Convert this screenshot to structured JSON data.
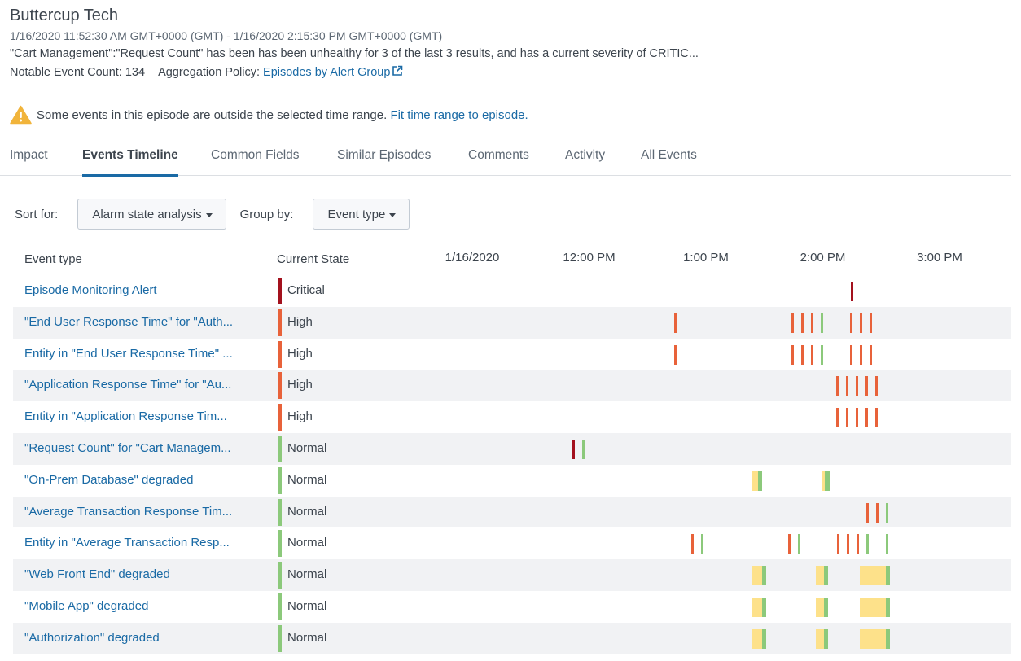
{
  "header": {
    "title": "Buttercup Tech",
    "time_range": "1/16/2020 11:52:30 AM GMT+0000 (GMT) - 1/16/2020 2:15:30 PM GMT+0000 (GMT)",
    "description": "\"Cart Management\":\"Request Count\" has been has been unhealthy for 3 of the last 3 results, and has a current severity of CRITIC...",
    "notable_event_count_label": "Notable Event Count: 134",
    "aggregation_policy_label": "Aggregation Policy:",
    "aggregation_policy_link": "Episodes by Alert Group",
    "external_link_icon": "external-link-icon"
  },
  "warning": {
    "icon": "warning-triangle-icon",
    "text": "Some events in this episode are outside the selected time range.",
    "link": "Fit time range to episode."
  },
  "tabs": [
    {
      "label": "Impact",
      "active": false
    },
    {
      "label": "Events Timeline",
      "active": true
    },
    {
      "label": "Common Fields",
      "active": false
    },
    {
      "label": "Similar Episodes",
      "active": false
    },
    {
      "label": "Comments",
      "active": false
    },
    {
      "label": "Activity",
      "active": false
    },
    {
      "label": "All Events",
      "active": false
    }
  ],
  "controls": {
    "sort_label": "Sort for:",
    "sort_value": "Alarm state analysis",
    "group_label": "Group by:",
    "group_value": "Event type"
  },
  "colors": {
    "critical": "#a3111d",
    "high": "#e8623a",
    "normal": "#8cc97b",
    "medium": "#fde18a",
    "link": "#1a6aa5",
    "row_alt": "#f1f2f4",
    "warning": "#f1b43b"
  },
  "grid": {
    "col_event_type": "Event type",
    "col_current_state": "Current State",
    "axis": {
      "start": "11:00",
      "end": "15:30",
      "ticks": [
        {
          "time": "11:00",
          "label": "1/16/2020"
        },
        {
          "time": "12:00",
          "label": "12:00 PM"
        },
        {
          "time": "13:00",
          "label": "1:00 PM"
        },
        {
          "time": "14:00",
          "label": "2:00 PM"
        },
        {
          "time": "15:00",
          "label": "3:00 PM"
        }
      ]
    },
    "rows": [
      {
        "name": "Episode Monitoring Alert",
        "state": "Critical",
        "severity": "critical",
        "events": [
          {
            "start": "14:15",
            "severity": "critical"
          }
        ]
      },
      {
        "name": "\"End User Response Time\" for \"Auth...",
        "state": "High",
        "severity": "high",
        "events": [
          {
            "start": "12:44.5",
            "severity": "high"
          },
          {
            "start": "13:44.5",
            "severity": "high"
          },
          {
            "start": "13:49.5",
            "severity": "high"
          },
          {
            "start": "13:54.5",
            "severity": "high"
          },
          {
            "start": "13:59.5",
            "severity": "normal"
          },
          {
            "start": "14:14.5",
            "severity": "high"
          },
          {
            "start": "14:19.5",
            "severity": "high"
          },
          {
            "start": "14:24.5",
            "severity": "high"
          }
        ]
      },
      {
        "name": "Entity in \"End User Response Time\" ...",
        "state": "High",
        "severity": "high",
        "events": [
          {
            "start": "12:44.5",
            "severity": "high"
          },
          {
            "start": "13:44.5",
            "severity": "high"
          },
          {
            "start": "13:49.5",
            "severity": "high"
          },
          {
            "start": "13:54.5",
            "severity": "high"
          },
          {
            "start": "13:59.5",
            "severity": "normal"
          },
          {
            "start": "14:14.5",
            "severity": "high"
          },
          {
            "start": "14:19.5",
            "severity": "high"
          },
          {
            "start": "14:24.5",
            "severity": "high"
          }
        ]
      },
      {
        "name": "\"Application Response Time\" for \"Au...",
        "state": "High",
        "severity": "high",
        "events": [
          {
            "start": "14:07.5",
            "severity": "high"
          },
          {
            "start": "14:12.5",
            "severity": "high"
          },
          {
            "start": "14:17.5",
            "severity": "high"
          },
          {
            "start": "14:22.5",
            "severity": "high"
          },
          {
            "start": "14:27.5",
            "severity": "high"
          }
        ]
      },
      {
        "name": "Entity in \"Application Response Tim...",
        "state": "High",
        "severity": "high",
        "events": [
          {
            "start": "14:07.5",
            "severity": "high"
          },
          {
            "start": "14:12.5",
            "severity": "high"
          },
          {
            "start": "14:17.5",
            "severity": "high"
          },
          {
            "start": "14:22.5",
            "severity": "high"
          },
          {
            "start": "14:27.5",
            "severity": "high"
          }
        ]
      },
      {
        "name": "\"Request Count\" for \"Cart Managem...",
        "state": "Normal",
        "severity": "normal",
        "events": [
          {
            "start": "11:52",
            "severity": "critical"
          },
          {
            "start": "11:57",
            "severity": "normal"
          }
        ]
      },
      {
        "name": "\"On-Prem Database\" degraded",
        "state": "Normal",
        "severity": "normal",
        "events": [
          {
            "start": "13:23.5",
            "end": "13:26.8",
            "severity": "medium"
          },
          {
            "start": "13:26.8",
            "end": "13:29",
            "severity": "normal"
          },
          {
            "start": "13:59.5",
            "end": "14:01.2",
            "severity": "medium"
          },
          {
            "start": "14:01.2",
            "end": "14:03.7",
            "severity": "normal"
          }
        ]
      },
      {
        "name": "\"Average Transaction Response Tim...",
        "state": "Normal",
        "severity": "normal",
        "events": [
          {
            "start": "14:23",
            "severity": "high"
          },
          {
            "start": "14:28",
            "severity": "high"
          },
          {
            "start": "14:33",
            "severity": "normal"
          }
        ]
      },
      {
        "name": "Entity in \"Average Transaction Resp...",
        "state": "Normal",
        "severity": "normal",
        "events": [
          {
            "start": "12:53",
            "severity": "high"
          },
          {
            "start": "12:58",
            "severity": "normal"
          },
          {
            "start": "13:43",
            "severity": "high"
          },
          {
            "start": "13:48",
            "severity": "normal"
          },
          {
            "start": "14:08",
            "severity": "high"
          },
          {
            "start": "14:13",
            "severity": "high"
          },
          {
            "start": "14:18",
            "severity": "high"
          },
          {
            "start": "14:23",
            "severity": "normal"
          },
          {
            "start": "14:33",
            "severity": "normal"
          }
        ]
      },
      {
        "name": "\"Web Front End\" degraded",
        "state": "Normal",
        "severity": "normal",
        "events": [
          {
            "start": "13:23.5",
            "end": "13:29",
            "severity": "medium"
          },
          {
            "start": "13:29",
            "end": "13:31",
            "severity": "normal"
          },
          {
            "start": "13:56.5",
            "end": "14:00.7",
            "severity": "medium"
          },
          {
            "start": "14:00.7",
            "end": "14:02.8",
            "severity": "normal"
          },
          {
            "start": "14:19",
            "end": "14:32.4",
            "severity": "medium"
          },
          {
            "start": "14:32.4",
            "end": "14:34.5",
            "severity": "normal"
          }
        ]
      },
      {
        "name": "\"Mobile App\" degraded",
        "state": "Normal",
        "severity": "normal",
        "events": [
          {
            "start": "13:23.5",
            "end": "13:29",
            "severity": "medium"
          },
          {
            "start": "13:29",
            "end": "13:31",
            "severity": "normal"
          },
          {
            "start": "13:56.5",
            "end": "14:00.7",
            "severity": "medium"
          },
          {
            "start": "14:00.7",
            "end": "14:02.8",
            "severity": "normal"
          },
          {
            "start": "14:19",
            "end": "14:32.4",
            "severity": "medium"
          },
          {
            "start": "14:32.4",
            "end": "14:34.5",
            "severity": "normal"
          }
        ]
      },
      {
        "name": "\"Authorization\" degraded",
        "state": "Normal",
        "severity": "normal",
        "events": [
          {
            "start": "13:23.5",
            "end": "13:29",
            "severity": "medium"
          },
          {
            "start": "13:29",
            "end": "13:31",
            "severity": "normal"
          },
          {
            "start": "13:56.5",
            "end": "14:00.7",
            "severity": "medium"
          },
          {
            "start": "14:00.7",
            "end": "14:02.8",
            "severity": "normal"
          },
          {
            "start": "14:19",
            "end": "14:32.4",
            "severity": "medium"
          },
          {
            "start": "14:32.4",
            "end": "14:34.5",
            "severity": "normal"
          }
        ]
      }
    ]
  }
}
